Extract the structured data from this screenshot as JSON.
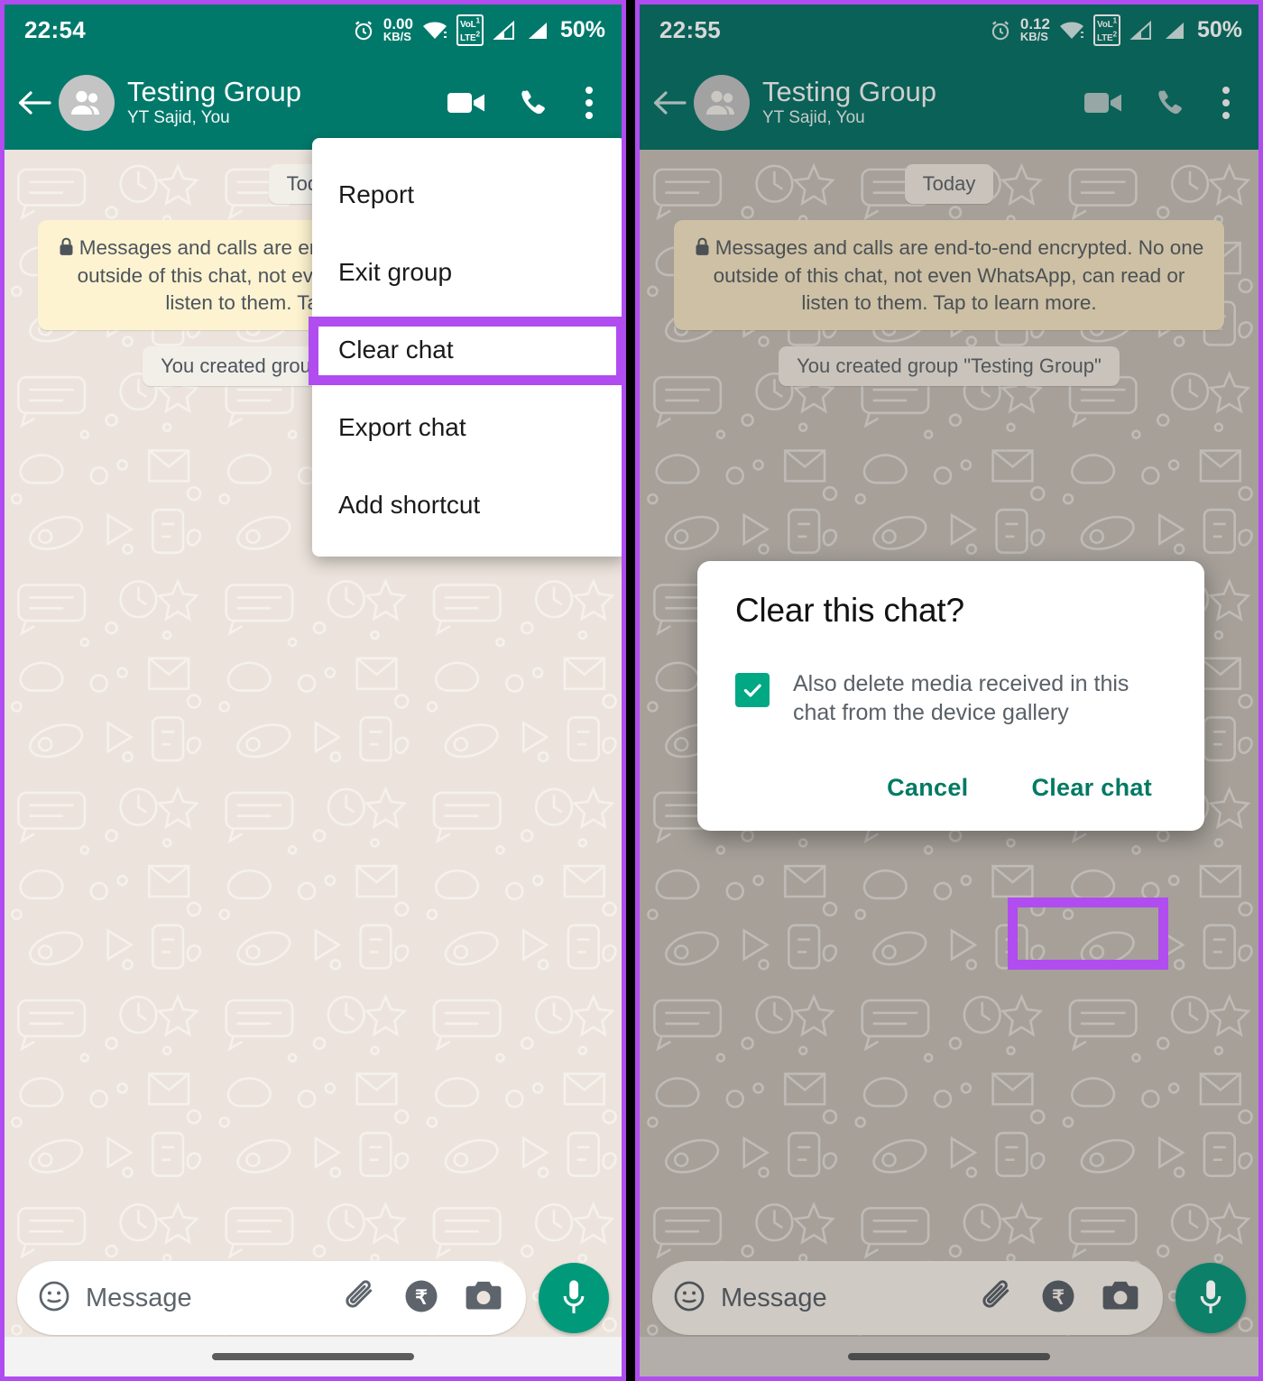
{
  "panels": {
    "left": {
      "status": {
        "time": "22:54",
        "net_speed_value": "0.00",
        "net_speed_unit": "KB/S",
        "volte": "VoLTE",
        "sim1": "1",
        "sim2": "2",
        "battery": "50%"
      },
      "appbar": {
        "title": "Testing Group",
        "subtitle": "YT Sajid, You",
        "back": "back-arrow",
        "video": "video-call",
        "voice": "voice-call",
        "menu": "more-options"
      },
      "chat": {
        "date_pill": "Today",
        "encryption_notice": "Messages and calls are end-to-end encrypted. No one outside of this chat, not even WhatsApp, can read or listen to them. Tap to learn more.",
        "system_message": "You created group \"Testing Group\""
      },
      "menu": {
        "items": [
          "Report",
          "Exit group",
          "Clear chat",
          "Export chat",
          "Add shortcut"
        ],
        "highlighted": "Clear chat"
      },
      "input": {
        "placeholder": "Message",
        "emoji": "emoji-icon",
        "attach": "attachment-icon",
        "payment": "rupee-payment-icon",
        "camera": "camera-icon",
        "mic": "microphone-icon"
      }
    },
    "right": {
      "status": {
        "time": "22:55",
        "net_speed_value": "0.12",
        "net_speed_unit": "KB/S",
        "volte": "VoLTE",
        "sim1": "1",
        "sim2": "2",
        "battery": "50%"
      },
      "appbar": {
        "title": "Testing Group",
        "subtitle": "YT Sajid, You"
      },
      "chat": {
        "date_pill": "Today",
        "encryption_notice": "Messages and calls are end-to-end encrypted. No one outside of this chat, not even WhatsApp, can read or listen to them. Tap to learn more.",
        "system_message": "You created group \"Testing Group\""
      },
      "dialog": {
        "title": "Clear this chat?",
        "checkbox_label": "Also delete media received in this chat from the device gallery",
        "checkbox_checked": true,
        "cancel_label": "Cancel",
        "confirm_label": "Clear chat",
        "highlighted": "Clear chat"
      },
      "input": {
        "placeholder": "Message"
      }
    }
  },
  "colors": {
    "whatsapp_green": "#00796b",
    "accent_teal": "#00a884",
    "highlight_purple": "#b04cf0",
    "chat_bg": "#ece4dc",
    "encryption_bubble": "#fdf3d0"
  }
}
